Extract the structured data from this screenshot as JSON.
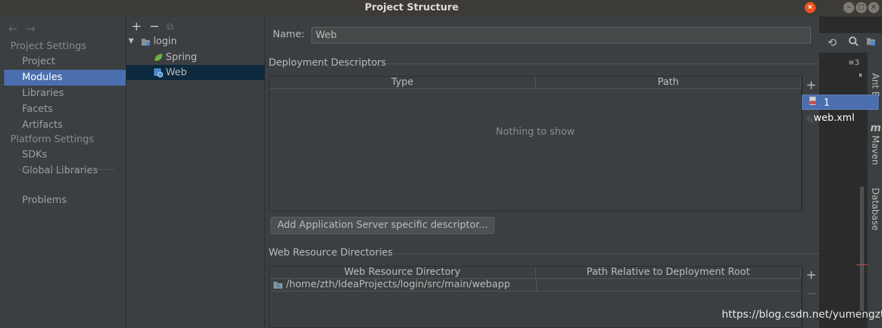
{
  "window": {
    "title": "Project Structure",
    "close_glyph": "×",
    "min_glyph": "–",
    "max_glyph": "□",
    "close2_glyph": "×"
  },
  "nav": {
    "back_glyph": "←",
    "forward_glyph": "→",
    "project_settings_header": "Project Settings",
    "project_settings_items": [
      "Project",
      "Modules",
      "Libraries",
      "Facets",
      "Artifacts"
    ],
    "platform_settings_header": "Platform Settings",
    "platform_settings_items": [
      "SDKs",
      "Global Libraries"
    ],
    "problems": "Problems",
    "selected": "Modules"
  },
  "tree": {
    "toolbar": {
      "add": "+",
      "remove": "−",
      "copy": "⧉"
    },
    "root": "login",
    "children": [
      "Spring",
      "Web"
    ],
    "selected": "Web",
    "expander": "▼"
  },
  "facet": {
    "name_label": "Name:",
    "name_value": "Web",
    "deployment_descriptors_title": "Deployment Descriptors",
    "dd_columns": [
      "Type",
      "Path"
    ],
    "dd_empty": "Nothing to show",
    "add_server_descriptor_button": "Add Application Server specific descriptor...",
    "web_resource_title": "Web Resource Directories",
    "wr_columns": [
      "Web Resource Directory",
      "Path Relative to Deployment Root"
    ],
    "wr_rows": [
      {
        "directory": "/home/zth/IdeaProjects/login/src/main/webapp",
        "relative": ""
      }
    ],
    "tools": {
      "add": "+",
      "remove": "−",
      "edit": "✎"
    }
  },
  "popup": {
    "index": "1",
    "label": "web.xml"
  },
  "ide": {
    "ant_label": "Ant B",
    "maven_label": "Maven",
    "database_label": "Database",
    "maven_glyph": "m",
    "pause_glyph": "⏸",
    "menu_glyph": "≡3"
  },
  "watermark": "https://blog.csdn.net/yumengzth",
  "colors": {
    "selection": "#4b6eaf",
    "tree_selection": "#0d293e",
    "panel": "#3c3f41",
    "close_button": "#e95420"
  }
}
